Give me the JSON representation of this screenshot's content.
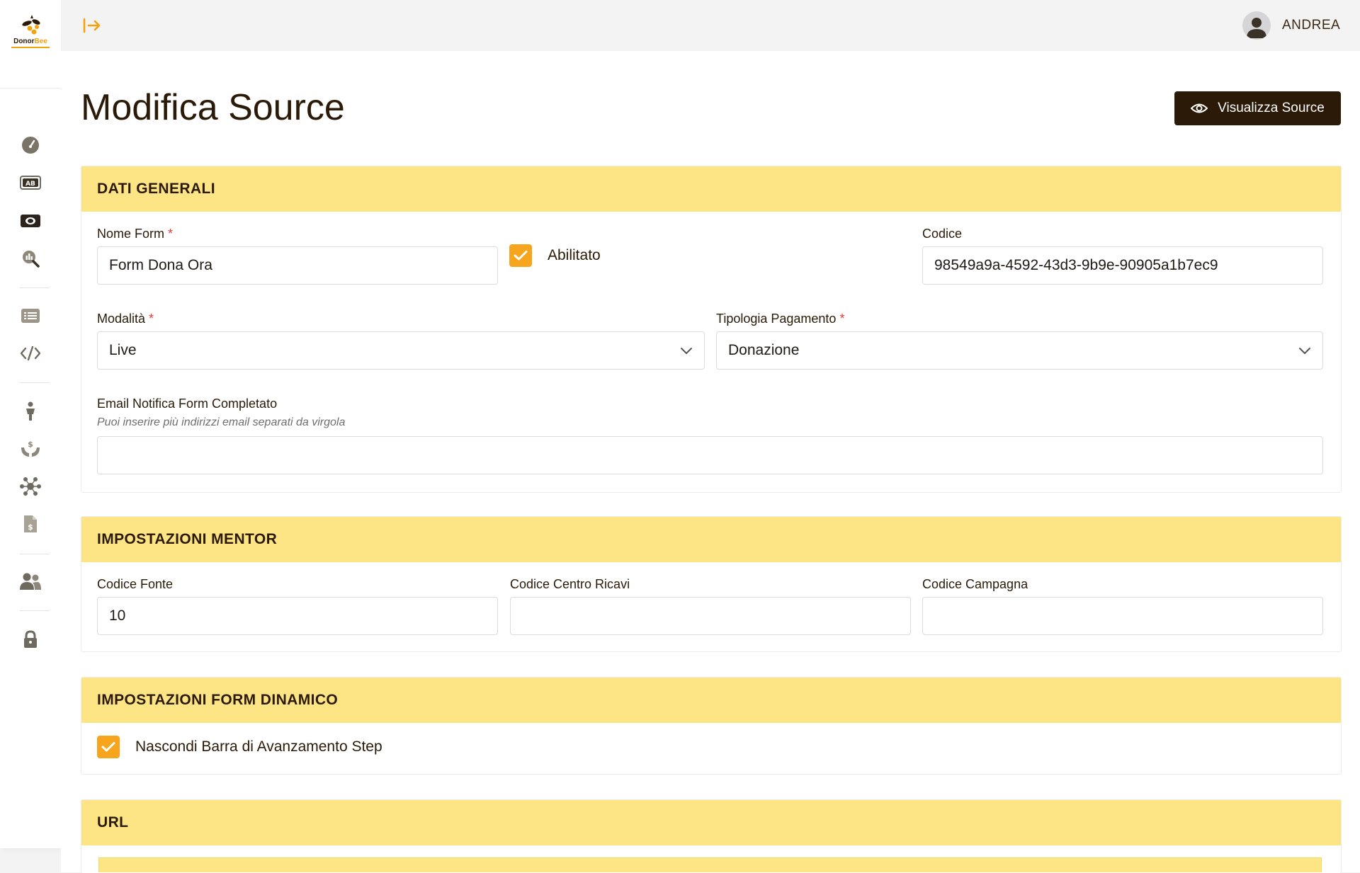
{
  "app": {
    "logo_left": "Donor",
    "logo_right": "Bee"
  },
  "user": {
    "name": "ANDREA"
  },
  "page": {
    "title": "Modifica Source",
    "view_button": "Visualizza Source"
  },
  "sidebar": {
    "icons": [
      "dashboard-icon",
      "ab-test-icon",
      "money-icon",
      "analytics-icon",
      "list-icon",
      "code-icon",
      "person-icon",
      "donation-hands-icon",
      "network-icon",
      "invoice-icon",
      "users-icon",
      "lock-icon"
    ]
  },
  "dati_generali": {
    "title": "DATI GENERALI",
    "nome_form_label": "Nome Form",
    "nome_form_value": "Form Dona Ora",
    "abilitato_label": "Abilitato",
    "abilitato_checked": true,
    "codice_label": "Codice",
    "codice_value": "98549a9a-4592-43d3-9b9e-90905a1b7ec9",
    "modalita_label": "Modalità",
    "modalita_value": "Live",
    "tipologia_label": "Tipologia Pagamento",
    "tipologia_value": "Donazione",
    "email_label": "Email Notifica Form Completato",
    "email_hint": "Puoi inserire più indirizzi email separati da virgola",
    "email_value": "",
    "required_mark": "*"
  },
  "impostazioni_mentor": {
    "title": "IMPOSTAZIONI MENTOR",
    "codice_fonte_label": "Codice Fonte",
    "codice_fonte_value": "10",
    "centro_ricavi_label": "Codice Centro Ricavi",
    "centro_ricavi_value": "",
    "campagna_label": "Codice Campagna",
    "campagna_value": ""
  },
  "impostazioni_form_dinamico": {
    "title": "IMPOSTAZIONI FORM DINAMICO",
    "nascondi_label": "Nascondi Barra di Avanzamento Step",
    "nascondi_checked": true
  },
  "url_section": {
    "title": "URL"
  },
  "colors": {
    "accent": "#f7a51c",
    "section_header": "#fde586",
    "dark": "#2a1a07"
  }
}
